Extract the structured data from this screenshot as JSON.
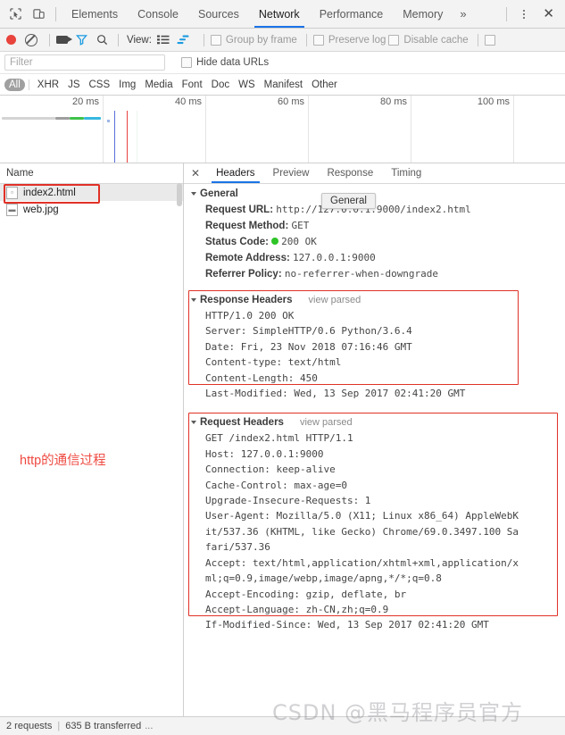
{
  "tabbar": {
    "icons": [
      "inspect-icon",
      "device-toolbar-icon"
    ],
    "tabs": [
      {
        "label": "Elements",
        "active": false
      },
      {
        "label": "Console",
        "active": false
      },
      {
        "label": "Sources",
        "active": false
      },
      {
        "label": "Network",
        "active": true
      },
      {
        "label": "Performance",
        "active": false
      },
      {
        "label": "Memory",
        "active": false
      }
    ],
    "more": "»",
    "close": "✕"
  },
  "toolbar": {
    "view_label": "View:",
    "checkboxes": [
      {
        "label": "Group by frame",
        "checked": false
      },
      {
        "label": "Preserve log",
        "checked": false
      },
      {
        "label": "Disable cache",
        "checked": false
      }
    ]
  },
  "filter": {
    "placeholder": "Filter",
    "value": "",
    "hide_data_urls": "Hide data URLs",
    "hide_data_urls_checked": false
  },
  "types": [
    {
      "label": "All",
      "active": true
    },
    {
      "label": "XHR",
      "active": false
    },
    {
      "label": "JS",
      "active": false
    },
    {
      "label": "CSS",
      "active": false
    },
    {
      "label": "Img",
      "active": false
    },
    {
      "label": "Media",
      "active": false
    },
    {
      "label": "Font",
      "active": false
    },
    {
      "label": "Doc",
      "active": false
    },
    {
      "label": "WS",
      "active": false
    },
    {
      "label": "Manifest",
      "active": false
    },
    {
      "label": "Other",
      "active": false
    }
  ],
  "overview": {
    "ticks": [
      "20 ms",
      "40 ms",
      "60 ms",
      "80 ms",
      "100 ms"
    ],
    "colors": {
      "wait": "#d4d4d4",
      "ttfb": "#4dbd4d",
      "download": "#35b8e0",
      "dom_content_loaded": "#3a5fe0",
      "load": "#e8433c"
    }
  },
  "requests": {
    "column_header": "Name",
    "items": [
      {
        "name": "index2.html",
        "selected": true
      },
      {
        "name": "web.jpg",
        "selected": false
      }
    ]
  },
  "annotation": "http的通信过程",
  "detail": {
    "tabs": [
      {
        "label": "Headers",
        "active": true
      },
      {
        "label": "Preview",
        "active": false
      },
      {
        "label": "Response",
        "active": false
      },
      {
        "label": "Timing",
        "active": false
      }
    ],
    "tooltip": "General",
    "general": {
      "title": "General",
      "rows": [
        {
          "key": "Request URL:",
          "value": "http://127.0.0.1:9000/index2.html"
        },
        {
          "key": "Request Method:",
          "value": "GET"
        },
        {
          "key": "Status Code:",
          "value": "200  OK",
          "status_dot": "#2ec428"
        },
        {
          "key": "Remote Address:",
          "value": "127.0.0.1:9000"
        },
        {
          "key": "Referrer Policy:",
          "value": "no-referrer-when-downgrade"
        }
      ]
    },
    "response_headers": {
      "title": "Response Headers",
      "view_parsed": "view parsed",
      "lines": [
        "HTTP/1.0 200 OK",
        "Server: SimpleHTTP/0.6 Python/3.6.4",
        "Date: Fri, 23 Nov 2018 07:16:46 GMT",
        "Content-type: text/html",
        "Content-Length: 450",
        "Last-Modified: Wed, 13 Sep 2017 02:41:20 GMT"
      ]
    },
    "request_headers": {
      "title": "Request Headers",
      "view_parsed": "view parsed",
      "lines": [
        "GET /index2.html HTTP/1.1",
        "Host: 127.0.0.1:9000",
        "Connection: keep-alive",
        "Cache-Control: max-age=0",
        "Upgrade-Insecure-Requests: 1",
        "User-Agent: Mozilla/5.0 (X11; Linux x86_64) AppleWebK",
        "it/537.36 (KHTML, like Gecko) Chrome/69.0.3497.100 Sa",
        "fari/537.36",
        "Accept: text/html,application/xhtml+xml,application/x",
        "ml;q=0.9,image/webp,image/apng,*/*;q=0.8",
        "Accept-Encoding: gzip, deflate, br",
        "Accept-Language: zh-CN,zh;q=0.9",
        "If-Modified-Since: Wed, 13 Sep 2017 02:41:20 GMT"
      ]
    }
  },
  "statusbar": {
    "requests": "2 requests",
    "transferred": "635 B transferred",
    "ellipsis": "..."
  },
  "watermark": "CSDN @黑马程序员官方"
}
